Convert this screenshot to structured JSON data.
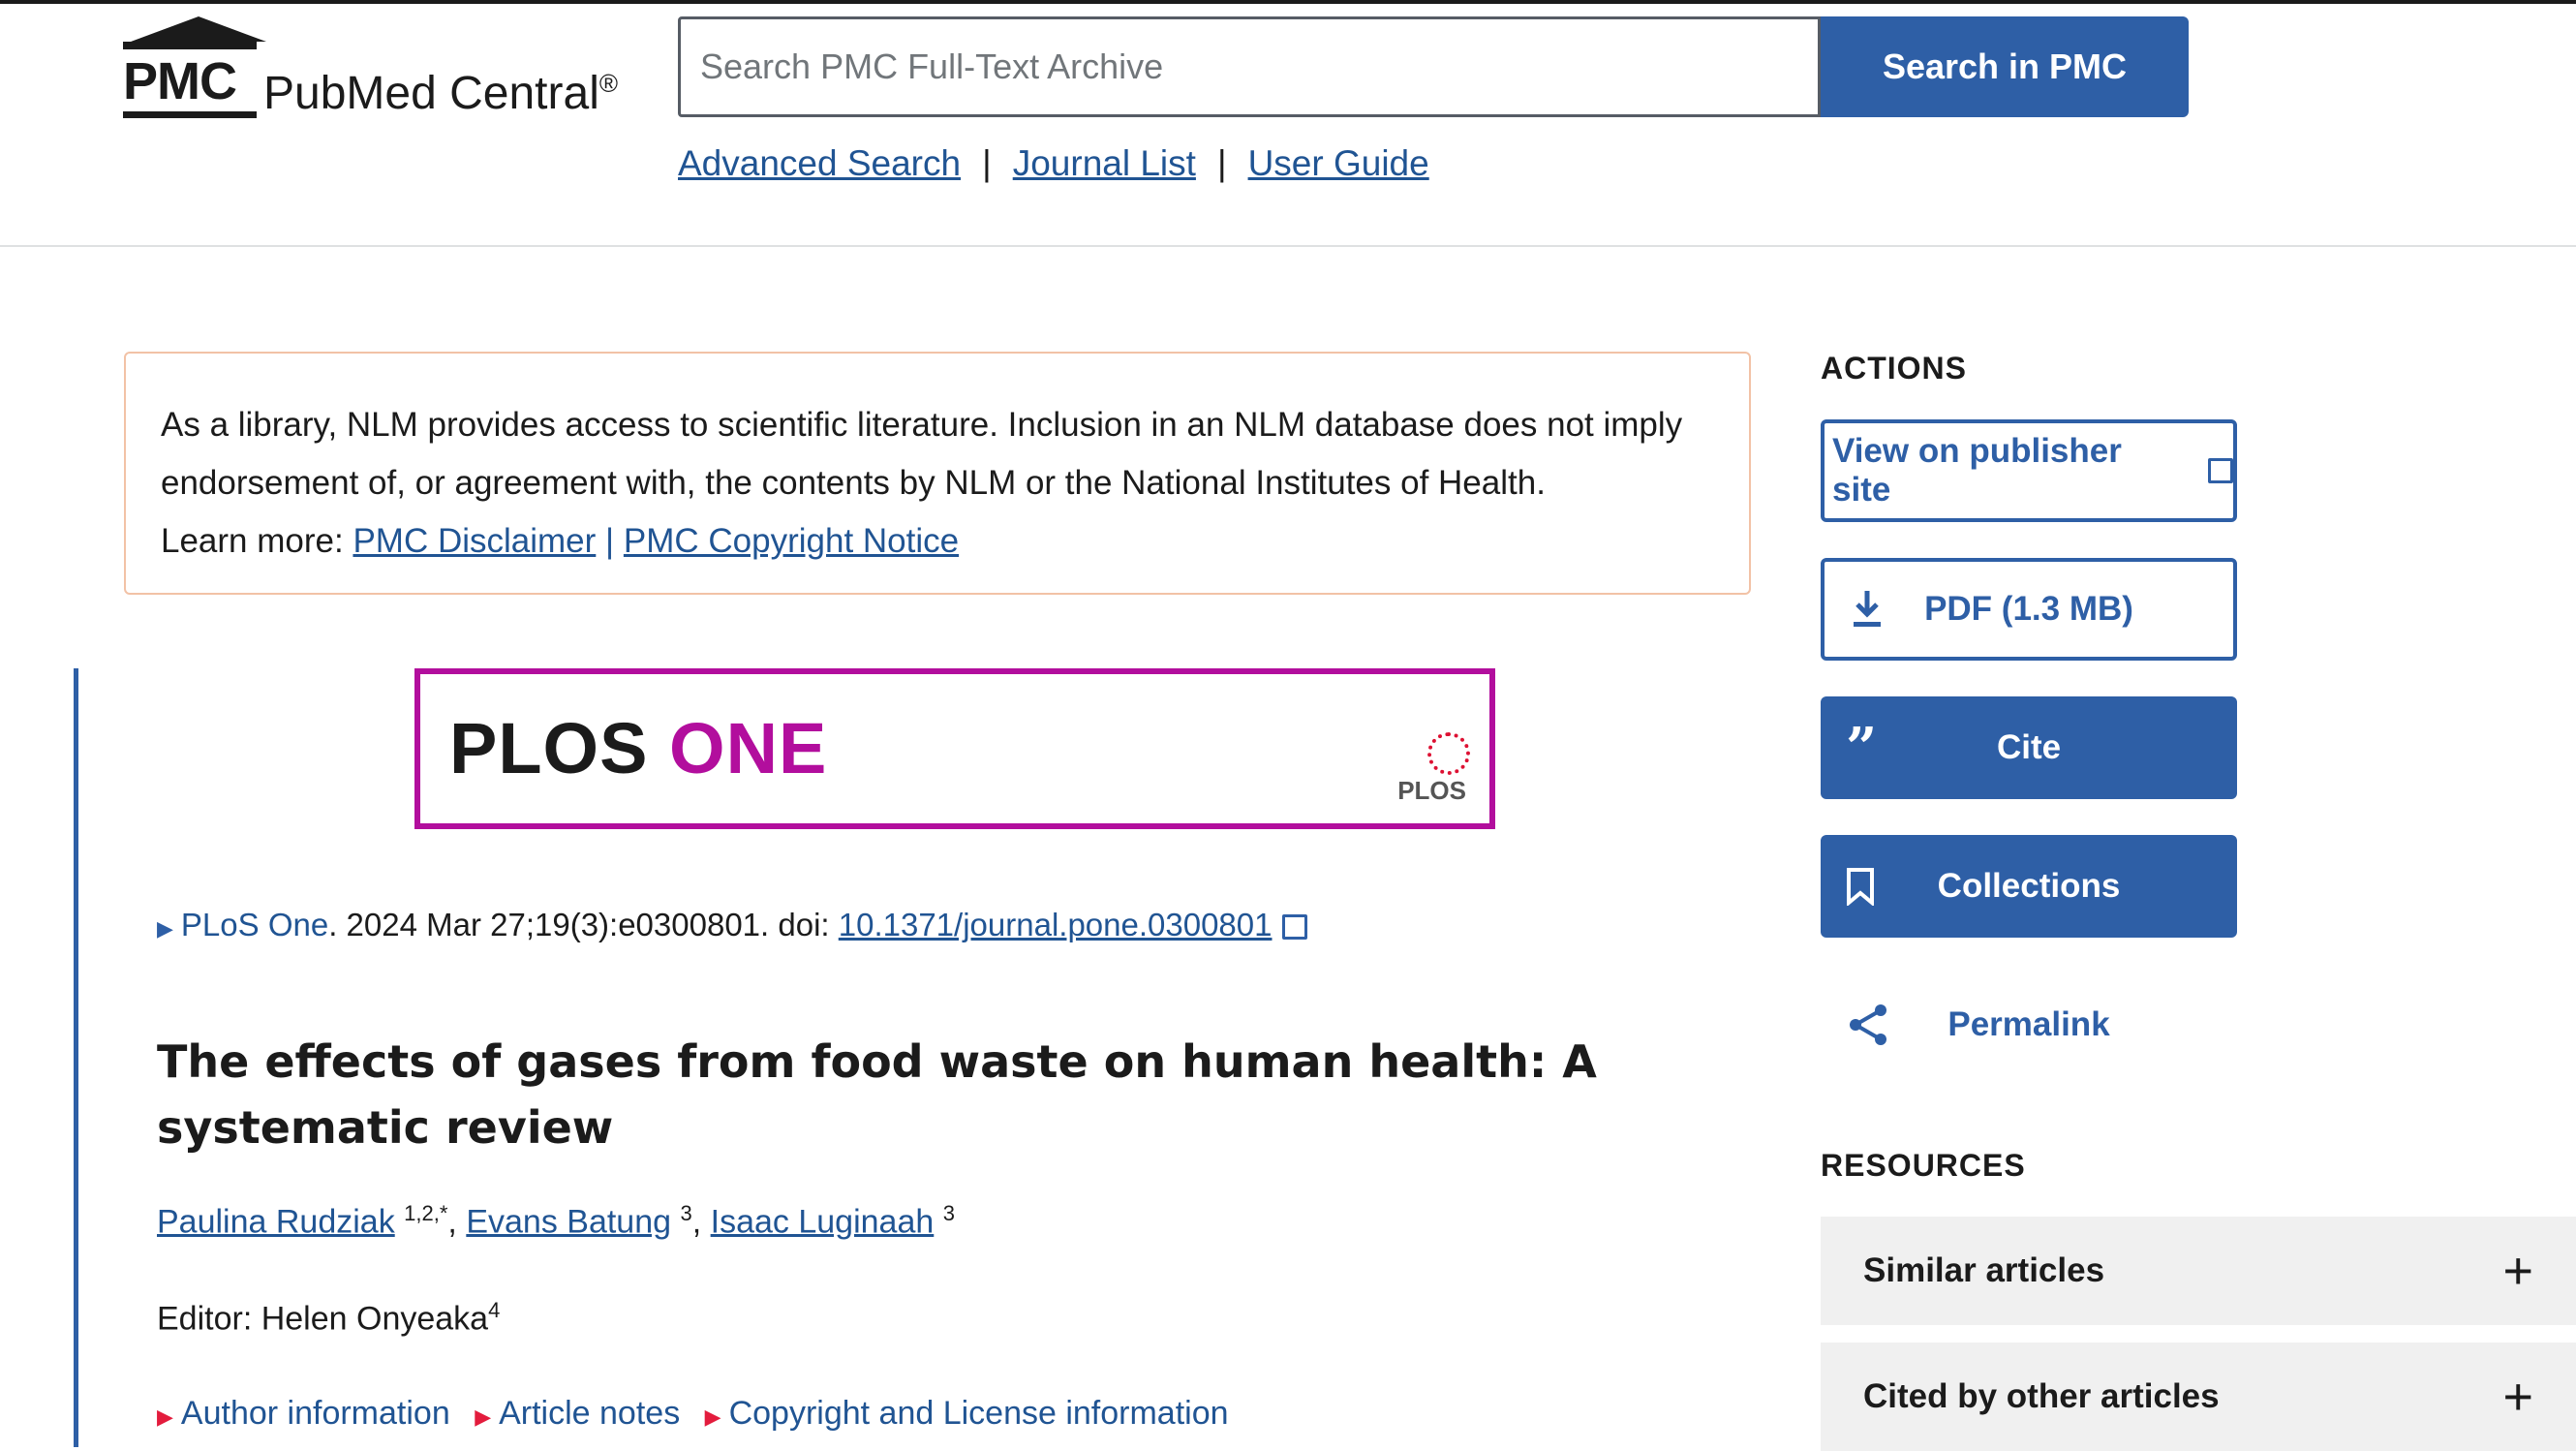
{
  "header": {
    "logo_abbr": "PMC",
    "logo_name": "PubMed Central",
    "logo_reg": "®",
    "search": {
      "placeholder": "Search PMC Full-Text Archive",
      "value": ""
    },
    "search_button": "Search in PMC",
    "links": [
      "Advanced Search",
      "Journal List",
      "User Guide"
    ],
    "separator": "|"
  },
  "disclaimer": {
    "text": "As a library, NLM provides access to scientific literature. Inclusion in an NLM database does not imply endorsement of, or agreement with, the contents by NLM or the National Institutes of Health.",
    "learn_more": "Learn more:",
    "link_disclaimer": "PMC Disclaimer",
    "separator": "|",
    "link_copyright": "PMC Copyright Notice"
  },
  "banner": {
    "word1": "PLOS",
    "word2": "ONE",
    "mini_logo": "PLOS",
    "border_color": "#b20e9d"
  },
  "citation": {
    "journal": "PLoS One",
    "details": ". 2024 Mar 27;19(3):e0300801. doi: ",
    "doi": "10.1371/journal.pone.0300801"
  },
  "article": {
    "title": "The effects of gases from food waste on human health: A systematic review",
    "authors": [
      {
        "name": "Paulina Rudziak",
        "aff": "1,2,*"
      },
      {
        "name": "Evans Batung",
        "aff": "3"
      },
      {
        "name": "Isaac Luginaah",
        "aff": "3"
      }
    ],
    "editor_label": "Editor: Helen Onyeaka",
    "editor_aff": "4",
    "info_links": [
      "Author information",
      "Article notes",
      "Copyright and License information"
    ]
  },
  "sidebar": {
    "actions_heading": "ACTIONS",
    "actions": {
      "publisher": "View on publisher site",
      "pdf": "PDF (1.3 MB)",
      "cite": "Cite",
      "collections": "Collections",
      "permalink": "Permalink"
    },
    "icons": {
      "download": "download-icon",
      "quote": "quote-icon",
      "bookmark": "bookmark-icon",
      "share": "share-icon",
      "external": "external-link-icon"
    },
    "resources_heading": "RESOURCES",
    "resources": [
      "Similar articles",
      "Cited by other articles"
    ],
    "expand_symbol": "+"
  },
  "colors": {
    "accent": "#2e5fa6",
    "link": "#205493",
    "disclaimer_border": "#f2c2a6",
    "red_marker": "#e31c3d"
  }
}
